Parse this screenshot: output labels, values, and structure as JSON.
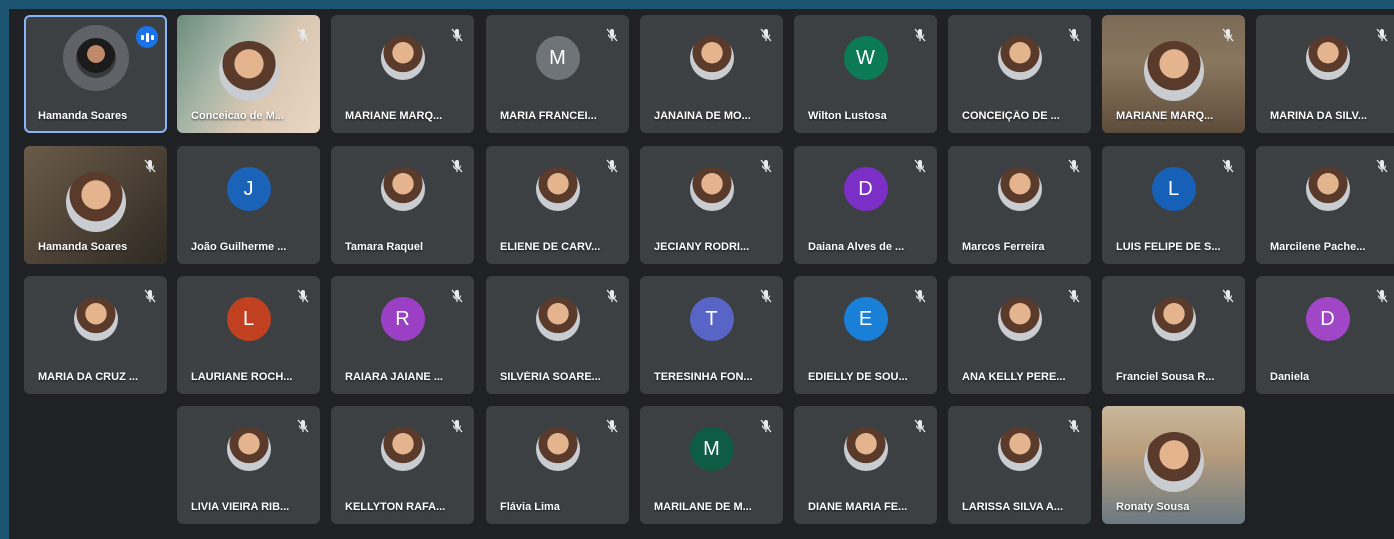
{
  "colors": {
    "frame": "#1d5472",
    "grid_bg": "#202124",
    "tile_bg": "#3c4043",
    "active_border": "#8ab4f8",
    "talk_badge": "#1a73e8"
  },
  "participants": [
    {
      "name": "Hamanda Soares",
      "avatar": "photo-ring",
      "active": true,
      "speaking": true
    },
    {
      "name": "Conceicao de M...",
      "avatar": "video",
      "muted": true
    },
    {
      "name": "MARIANE MARQ...",
      "avatar": "photo",
      "muted": true
    },
    {
      "name": "MARIA FRANCEI...",
      "avatar": "letter",
      "letter": "M",
      "color": "#6f7478",
      "muted": true
    },
    {
      "name": "JANAINA DE MO...",
      "avatar": "photo",
      "muted": true
    },
    {
      "name": "Wilton Lustosa",
      "avatar": "letter",
      "letter": "W",
      "color": "#0b7a55",
      "muted": true
    },
    {
      "name": "CONCEIÇÃO DE ...",
      "avatar": "photo",
      "muted": true
    },
    {
      "name": "MARIANE MARQ...",
      "avatar": "video",
      "muted": true
    },
    {
      "name": "MARINA DA SILV...",
      "avatar": "photo",
      "muted": true
    },
    {
      "name": "Hamanda Soares",
      "avatar": "video",
      "muted": true
    },
    {
      "name": "João Guilherme ...",
      "avatar": "letter",
      "letter": "J",
      "color": "#1a63b8",
      "muted": false
    },
    {
      "name": "Tamara Raquel",
      "avatar": "photo",
      "muted": true
    },
    {
      "name": "ELIENE DE CARV...",
      "avatar": "photo",
      "muted": true
    },
    {
      "name": "JECIANY RODRI...",
      "avatar": "photo",
      "muted": true
    },
    {
      "name": "Daiana Alves de ...",
      "avatar": "letter",
      "letter": "D",
      "color": "#7b2fc7",
      "muted": true
    },
    {
      "name": "Marcos Ferreira",
      "avatar": "photo",
      "muted": true
    },
    {
      "name": "LUIS FELIPE DE S...",
      "avatar": "letter",
      "letter": "L",
      "color": "#1660b8",
      "muted": true
    },
    {
      "name": "Marcilene Pache...",
      "avatar": "photo",
      "muted": true
    },
    {
      "name": "MARIA DA CRUZ ...",
      "avatar": "photo",
      "muted": true
    },
    {
      "name": "LAURIANE ROCH...",
      "avatar": "letter",
      "letter": "L",
      "color": "#c1401f",
      "muted": true
    },
    {
      "name": "RAIARA JAIANE ...",
      "avatar": "letter",
      "letter": "R",
      "color": "#9b3fc4",
      "muted": true
    },
    {
      "name": "SILVÉRIA SOARE...",
      "avatar": "photo",
      "muted": true
    },
    {
      "name": "TERESINHA FON...",
      "avatar": "letter",
      "letter": "T",
      "color": "#5865c6",
      "muted": true
    },
    {
      "name": "EDIELLY DE SOU...",
      "avatar": "letter",
      "letter": "E",
      "color": "#1a7fd6",
      "muted": true
    },
    {
      "name": "ANA KELLY PERE...",
      "avatar": "photo",
      "muted": true
    },
    {
      "name": "Franciel Sousa R...",
      "avatar": "photo",
      "muted": true
    },
    {
      "name": "Daniela",
      "avatar": "letter",
      "letter": "D",
      "color": "#a046c7",
      "muted": true
    },
    {
      "name": "LIVIA VIEIRA RIB...",
      "avatar": "photo",
      "muted": true
    },
    {
      "name": "KELLYTON RAFA...",
      "avatar": "photo",
      "muted": true
    },
    {
      "name": "Flávia Lima",
      "avatar": "photo",
      "muted": true
    },
    {
      "name": "MARILANE DE M...",
      "avatar": "letter",
      "letter": "M",
      "color": "#0e5c44",
      "muted": true
    },
    {
      "name": "DIANE MARIA FE...",
      "avatar": "photo",
      "muted": true
    },
    {
      "name": "LARISSA SILVA A...",
      "avatar": "photo",
      "muted": true
    },
    {
      "name": "Ronaty Sousa",
      "avatar": "video",
      "muted": false
    }
  ]
}
